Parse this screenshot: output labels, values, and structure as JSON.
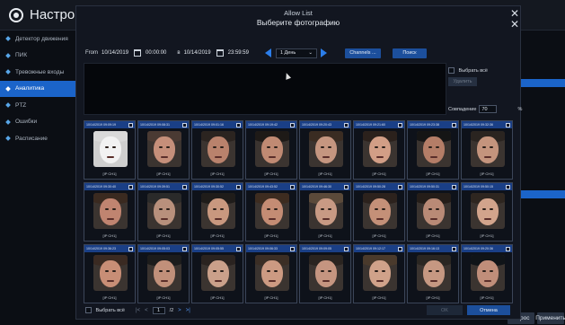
{
  "background": {
    "title": "Настройки",
    "sidebar": [
      {
        "label": "Детектор движения",
        "active": false
      },
      {
        "label": "ПИК",
        "active": false
      },
      {
        "label": "Тревожные входы",
        "active": false
      },
      {
        "label": "Аналитика",
        "active": true
      },
      {
        "label": "PTZ",
        "active": false
      },
      {
        "label": "Ошибки",
        "active": false
      },
      {
        "label": "Расписание",
        "active": false
      }
    ],
    "bottom_buttons": [
      "Сброс",
      "Применить"
    ]
  },
  "dialog": {
    "title": "Allow List",
    "subtitle": "Выберите фотографию",
    "from_label": "From",
    "from_date": "10/14/2019",
    "from_time": "00:00:00",
    "to_label": "в",
    "to_date": "10/14/2019",
    "to_time": "23:59:59",
    "range_select": "1 День",
    "channels_button": "Channels ...",
    "search_button": "Поиск",
    "select_all_label": "Выбрать всё",
    "delete_button": "Удалить",
    "match_label": "Совпадение",
    "match_value": "70",
    "match_unit": "%"
  },
  "thumbnails": [
    {
      "time": "10/14/2019 09:09:19",
      "channel": "[IP CH1]"
    },
    {
      "time": "10/14/2019 09:08:31",
      "channel": "[IP CH1]"
    },
    {
      "time": "10/14/2019 09:01:16",
      "channel": "[IP CH1]"
    },
    {
      "time": "10/14/2019 09:19:42",
      "channel": "[IP CH1]"
    },
    {
      "time": "10/14/2019 09:20:43",
      "channel": "[IP CH1]"
    },
    {
      "time": "10/14/2019 09:21:60",
      "channel": "[IP CH1]"
    },
    {
      "time": "10/14/2019 09:23:38",
      "channel": "[IP CH1]"
    },
    {
      "time": "10/14/2019 09:32:36",
      "channel": "[IP CH1]"
    },
    {
      "time": "10/14/2019 09:30:40",
      "channel": "[IP CH1]"
    },
    {
      "time": "10/14/2019 09:39:51",
      "channel": "[IP CH1]"
    },
    {
      "time": "10/14/2019 09:30:52",
      "channel": "[IP CH1]"
    },
    {
      "time": "10/14/2019 09:43:52",
      "channel": "[IP CH1]"
    },
    {
      "time": "10/14/2019 09:46:30",
      "channel": "[IP CH1]"
    },
    {
      "time": "10/14/2019 09:50:28",
      "channel": "[IP CH1]"
    },
    {
      "time": "10/14/2019 09:50:31",
      "channel": "[IP CH1]"
    },
    {
      "time": "10/14/2019 09:50:15",
      "channel": "[IP CH1]"
    },
    {
      "time": "10/14/2019 09:36:23",
      "channel": "[IP CH1]"
    },
    {
      "time": "10/14/2019 09:05:03",
      "channel": "[IP CH1]"
    },
    {
      "time": "10/14/2019 09:05:55",
      "channel": "[IP CH1]"
    },
    {
      "time": "10/14/2019 09:06:33",
      "channel": "[IP CH1]"
    },
    {
      "time": "10/14/2019 09:09:05",
      "channel": "[IP CH1]"
    },
    {
      "time": "10/14/2019 09:12:17",
      "channel": "[IP CH1]"
    },
    {
      "time": "10/14/2019 09:16:13",
      "channel": "[IP CH1]"
    },
    {
      "time": "10/14/2019 09:20:36",
      "channel": "[IP CH1]"
    }
  ],
  "footer": {
    "select_all_label": "Выбрать всё",
    "page_current": "1",
    "page_total": "/2",
    "ok_button": "OK",
    "cancel_button": "Отмена"
  },
  "colors": {
    "accent": "#1c4f9c",
    "active_sidebar": "#1b64c9",
    "arrow": "#2b7de9",
    "card_header": "#1a3f86"
  }
}
